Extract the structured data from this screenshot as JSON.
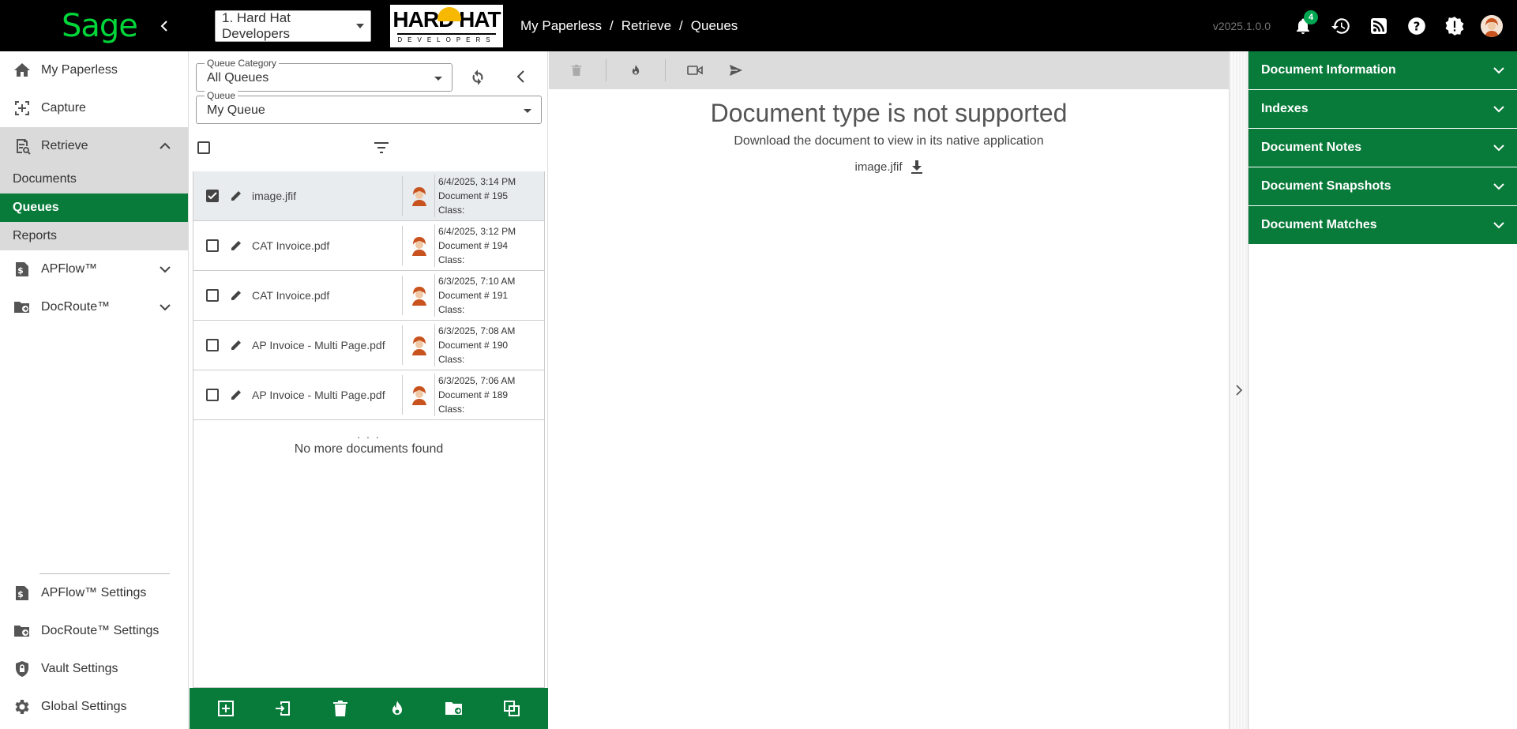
{
  "brand": {
    "logo_text": "Sage",
    "accent": "#087a3a"
  },
  "company": {
    "selected": "1. Hard Hat Developers"
  },
  "partner_logo": {
    "line1": "HARD HAT",
    "line2": "DEVELOPERS"
  },
  "breadcrumb": [
    "My Paperless",
    "Retrieve",
    "Queues"
  ],
  "version": "v2025.1.0.0",
  "notifications": {
    "count": "4"
  },
  "sidebar": {
    "items": [
      {
        "label": "My Paperless",
        "icon": "home-icon"
      },
      {
        "label": "Capture",
        "icon": "capture-icon"
      },
      {
        "label": "Retrieve",
        "icon": "retrieve-icon",
        "expanded": true
      },
      {
        "label": "APFlow™",
        "icon": "apflow-icon"
      },
      {
        "label": "DocRoute™",
        "icon": "docroute-icon"
      }
    ],
    "retrieve_sub": [
      "Documents",
      "Queues",
      "Reports"
    ],
    "bottom_items": [
      {
        "label": "APFlow™ Settings",
        "icon": "apflow-icon"
      },
      {
        "label": "DocRoute™ Settings",
        "icon": "docroute-icon"
      },
      {
        "label": "Vault Settings",
        "icon": "vault-icon"
      },
      {
        "label": "Global Settings",
        "icon": "gear-icon"
      }
    ]
  },
  "queue": {
    "category_label": "Queue Category",
    "category_value": "All Queues",
    "queue_label": "Queue",
    "queue_value": "My Queue",
    "documents": [
      {
        "name": "image.jfif",
        "date": "6/4/2025, 3:14 PM",
        "number": "Document # 195",
        "class": "Class:",
        "selected": true
      },
      {
        "name": "CAT Invoice.pdf",
        "date": "6/4/2025, 3:12 PM",
        "number": "Document # 194",
        "class": "Class:",
        "selected": false
      },
      {
        "name": "CAT Invoice.pdf",
        "date": "6/3/2025, 7:10 AM",
        "number": "Document # 191",
        "class": "Class:",
        "selected": false
      },
      {
        "name": "AP Invoice - Multi Page.pdf",
        "date": "6/3/2025, 7:08 AM",
        "number": "Document # 190",
        "class": "Class:",
        "selected": false
      },
      {
        "name": "AP Invoice - Multi Page.pdf",
        "date": "6/3/2025, 7:06 AM",
        "number": "Document # 189",
        "class": "Class:",
        "selected": false
      }
    ],
    "ellipsis": ". . .",
    "no_more": "No more documents found"
  },
  "viewer": {
    "title": "Document type is not supported",
    "subtitle": "Download the document to view in its native application",
    "file_name": "image.jfif"
  },
  "right_panel": {
    "sections": [
      "Document Information",
      "Indexes",
      "Document Notes",
      "Document Snapshots",
      "Document Matches"
    ]
  }
}
